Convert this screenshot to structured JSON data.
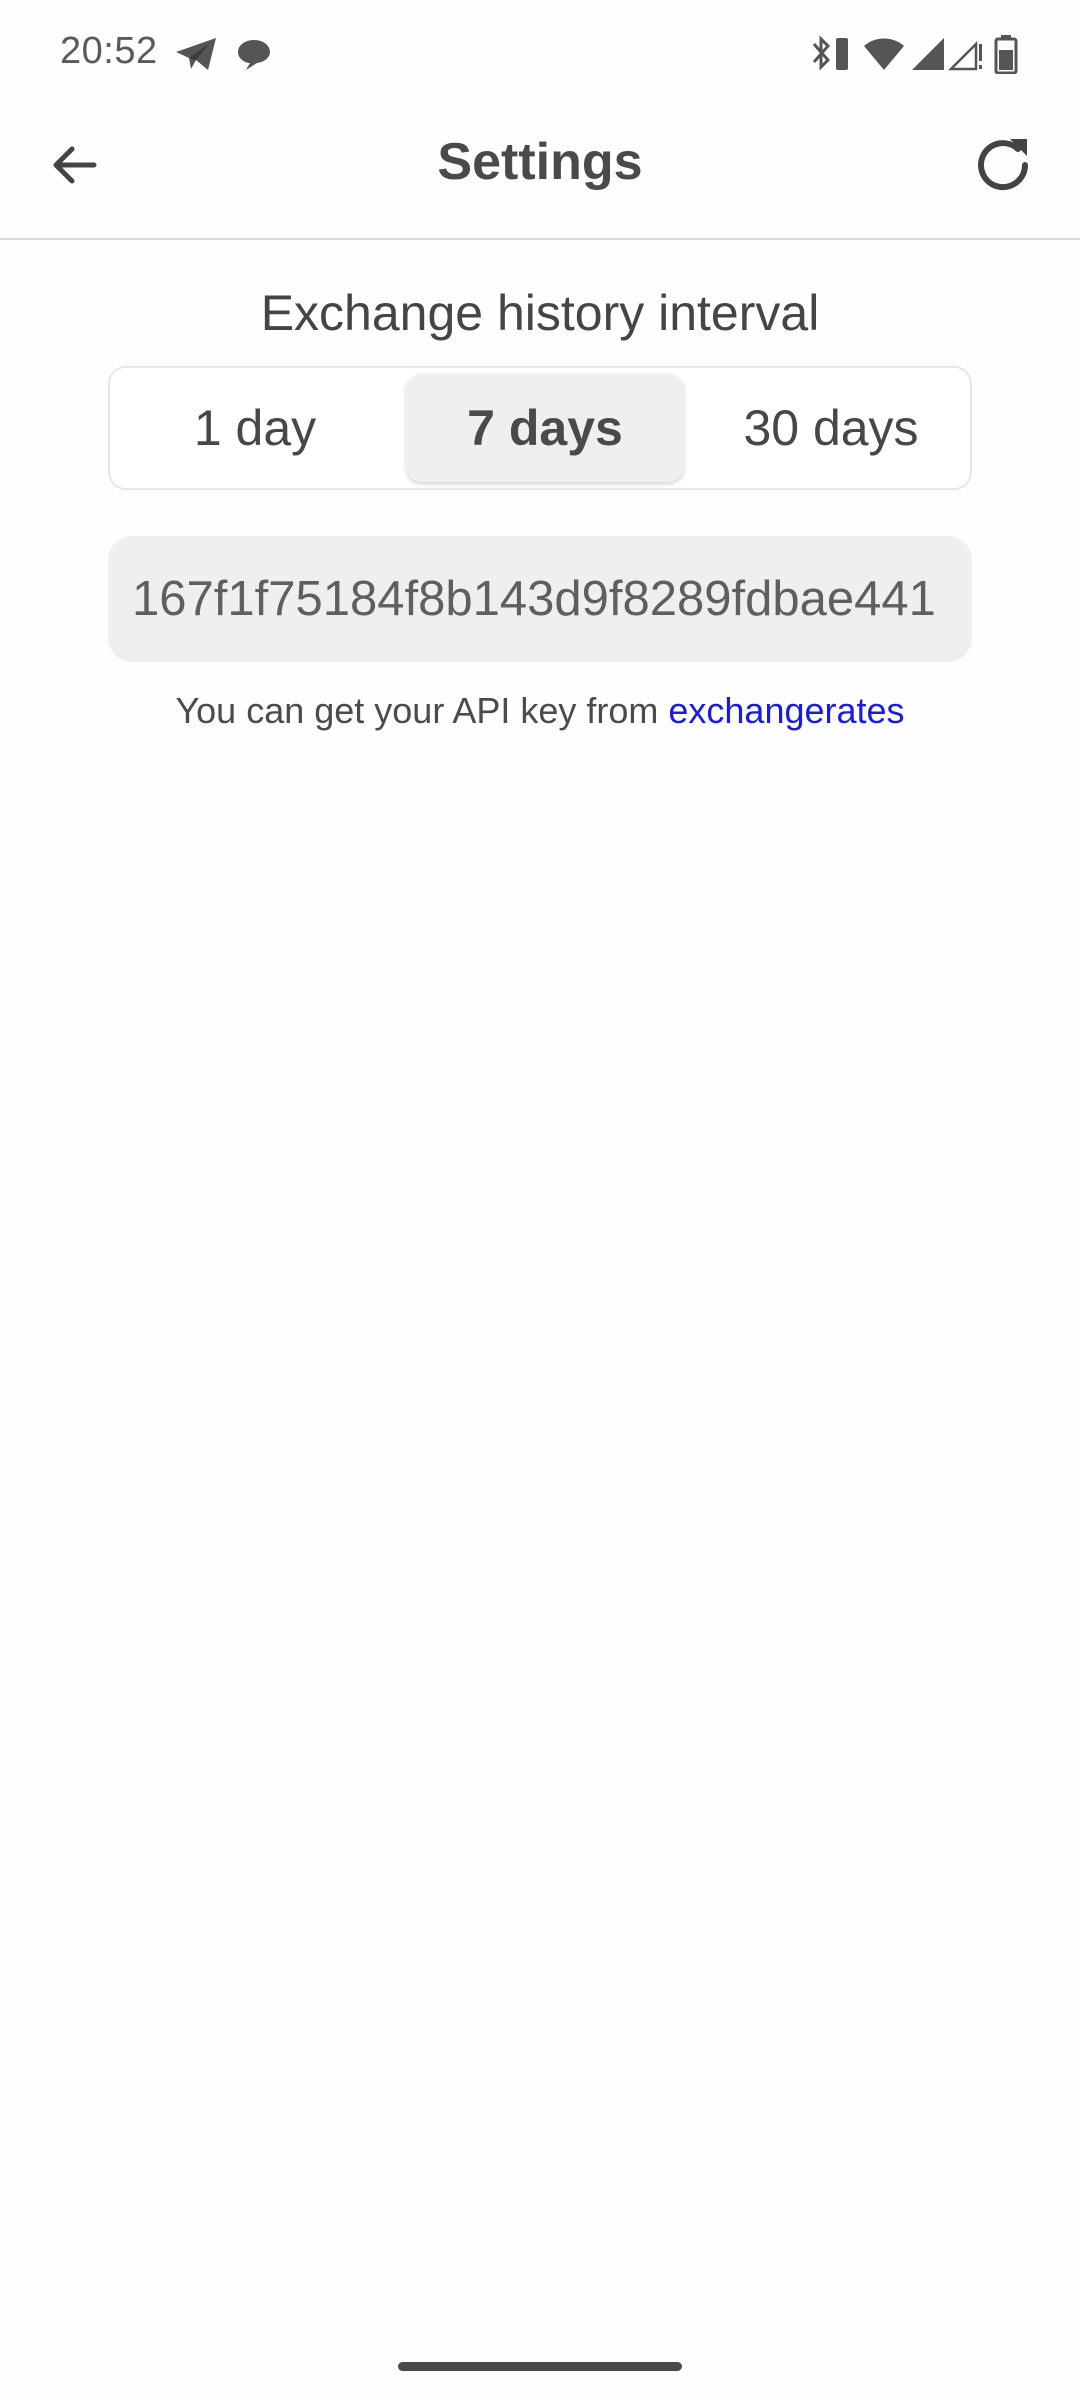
{
  "status_bar": {
    "time": "20:52",
    "left_icons": [
      "telegram-icon",
      "chat-bubble-icon"
    ],
    "right_icons": [
      "bluetooth-battery-icon",
      "wifi-icon",
      "cellular-signal-icon",
      "cellular-signal-empty-icon",
      "battery-icon"
    ]
  },
  "app_bar": {
    "title": "Settings",
    "back_icon": "arrow-left-icon",
    "refresh_icon": "refresh-icon"
  },
  "history": {
    "title": "Exchange history interval",
    "options": [
      "1 day",
      "7 days",
      "30 days"
    ],
    "selected": "7 days"
  },
  "api": {
    "value": "167f1f75184f8b143d9f8289fdbae441",
    "hint": "You can get your API key from ",
    "link": "exchangerates",
    "link_color": "#1a1ae6"
  },
  "colors": {
    "background": "#fefefe",
    "segment_selected": "#efefef",
    "input_background": "#efefef"
  }
}
